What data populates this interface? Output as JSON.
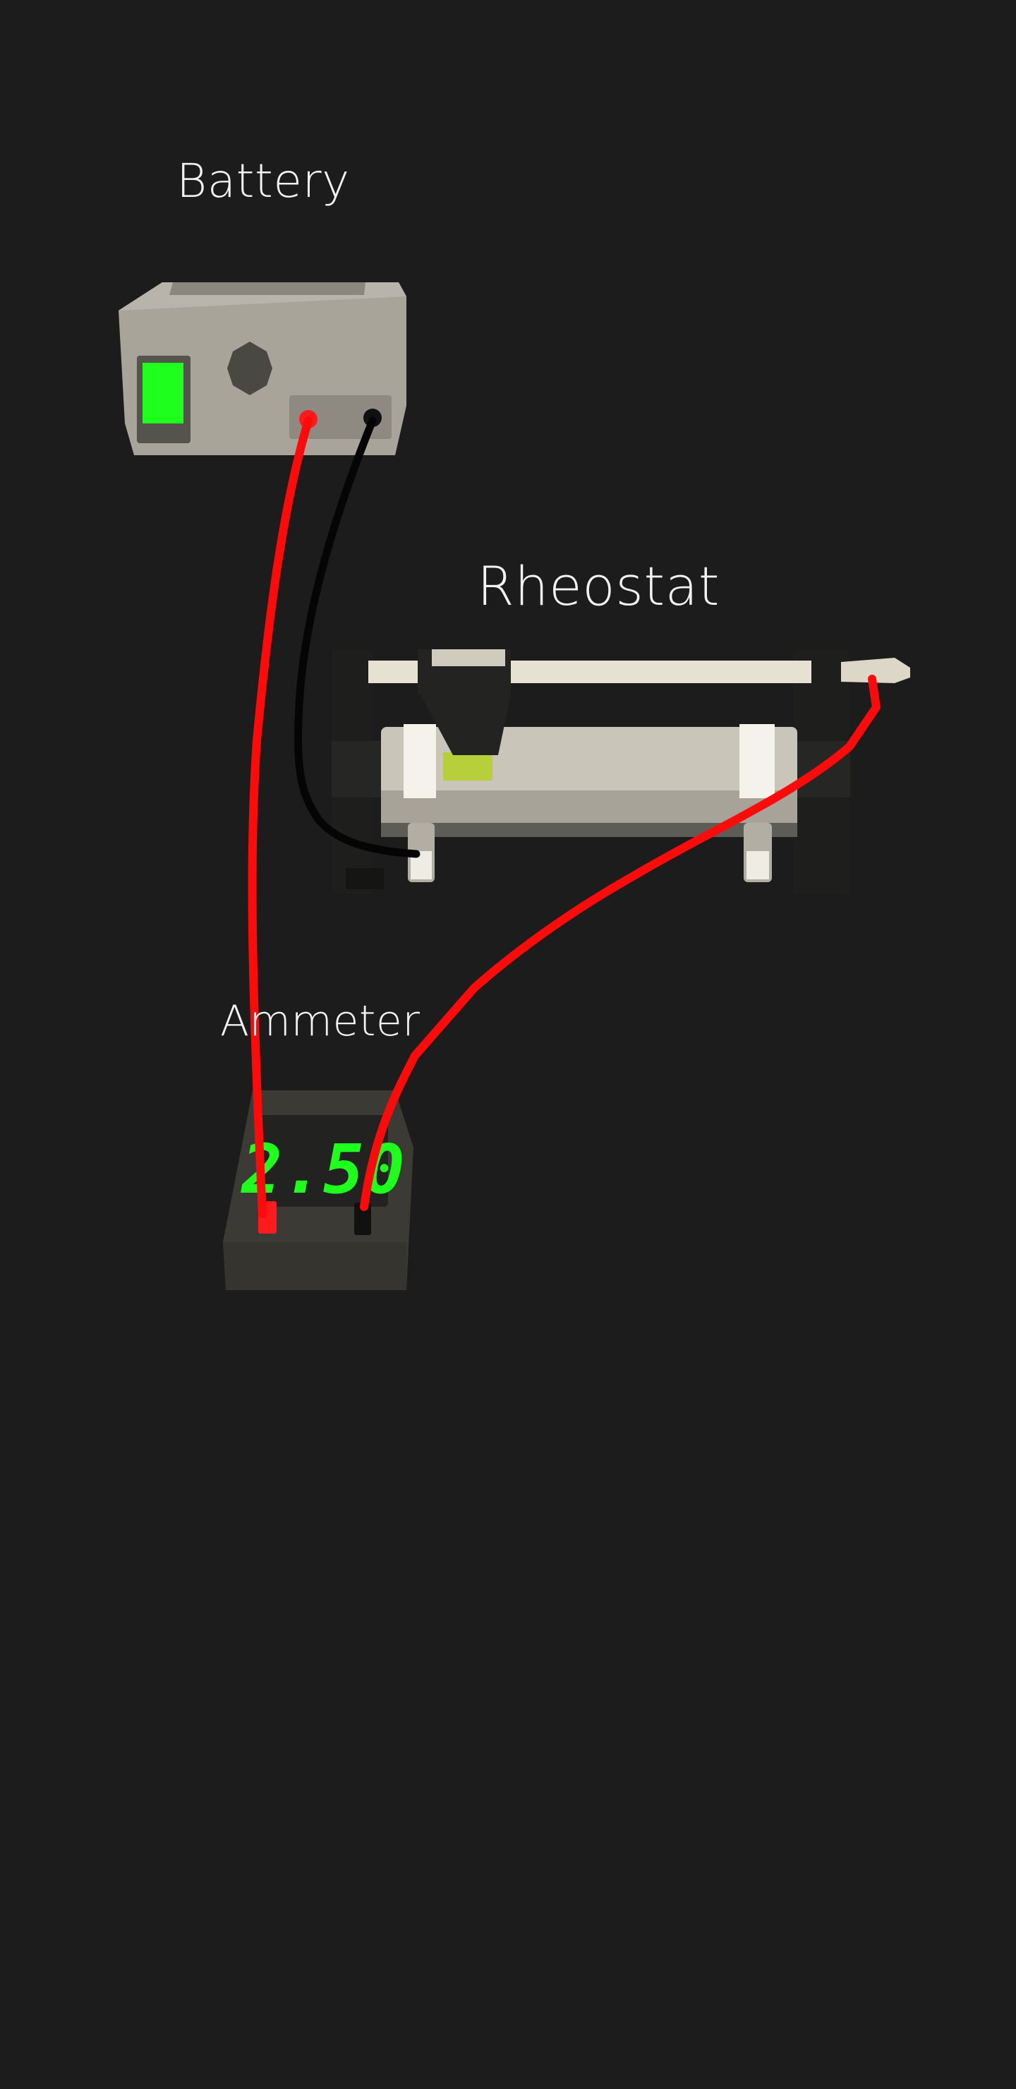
{
  "labels": {
    "battery": "Battery",
    "rheostat": "Rheostat",
    "ammeter": "Ammeter"
  },
  "ammeter": {
    "reading": "2.50"
  },
  "colors": {
    "background": "#1c1c1c",
    "positive_wire": "#ff0a0a",
    "negative_wire": "#050505",
    "display_green": "#1eff1e",
    "battery_body": "#a9a49a",
    "rheostat_coil": "#c9c5b8",
    "slider_contact": "#b6cf3a",
    "ammeter_body": "#3c3a34"
  }
}
